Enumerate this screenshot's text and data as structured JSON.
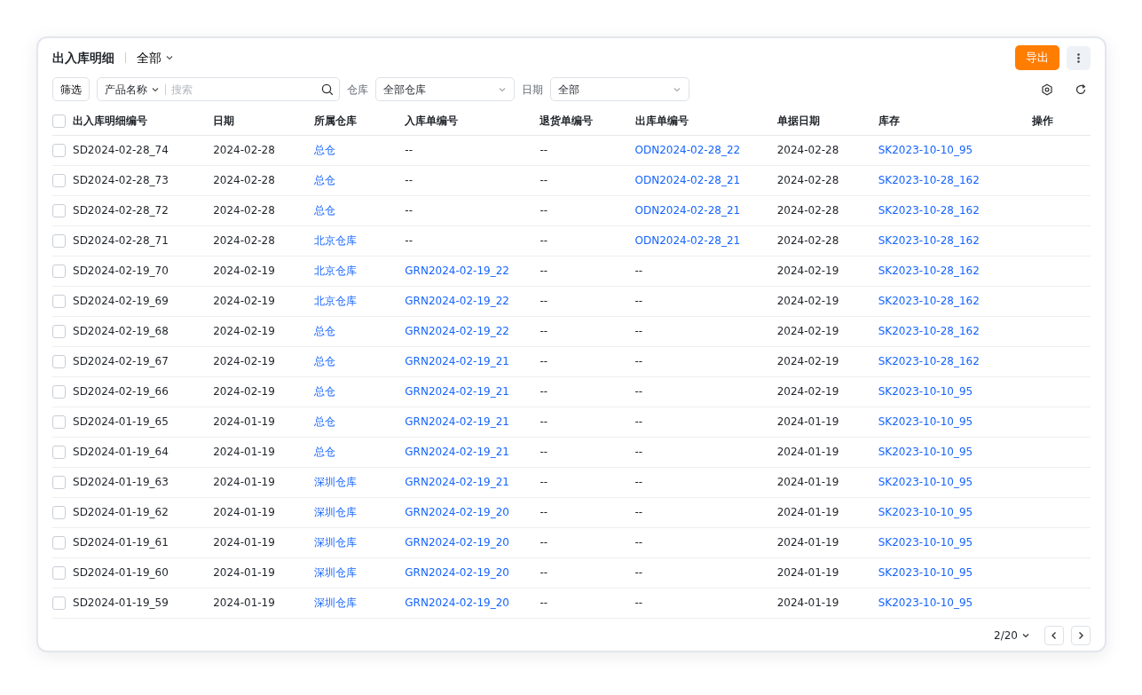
{
  "header": {
    "title": "出入库明细",
    "scope": "全部",
    "export": "导出"
  },
  "filters": {
    "filter_button": "筛选",
    "field": "产品名称",
    "search": {
      "placeholder": "搜索"
    },
    "warehouse_label": "仓库",
    "warehouse": "全部仓库",
    "date_label": "日期",
    "date": "全部"
  },
  "table": {
    "all_checked": false,
    "columns": [
      "出入库明细编号",
      "日期",
      "所属仓库",
      "入库单编号",
      "退货单编号",
      "出库单编号",
      "单据日期",
      "库存",
      "操作"
    ],
    "rows": [
      {
        "checked": false,
        "cells": [
          {
            "text": "SD2024-02-28_74",
            "link": false
          },
          {
            "text": "2024-02-28",
            "link": false
          },
          {
            "text": "总仓",
            "link": true
          },
          {
            "text": "--",
            "link": false
          },
          {
            "text": "--",
            "link": false
          },
          {
            "text": "ODN2024-02-28_22",
            "link": true
          },
          {
            "text": "2024-02-28",
            "link": false
          },
          {
            "text": "SK2023-10-10_95",
            "link": true
          }
        ]
      },
      {
        "checked": false,
        "cells": [
          {
            "text": "SD2024-02-28_73",
            "link": false
          },
          {
            "text": "2024-02-28",
            "link": false
          },
          {
            "text": "总仓",
            "link": true
          },
          {
            "text": "--",
            "link": false
          },
          {
            "text": "--",
            "link": false
          },
          {
            "text": "ODN2024-02-28_21",
            "link": true
          },
          {
            "text": "2024-02-28",
            "link": false
          },
          {
            "text": "SK2023-10-28_162",
            "link": true
          }
        ]
      },
      {
        "checked": false,
        "cells": [
          {
            "text": "SD2024-02-28_72",
            "link": false
          },
          {
            "text": "2024-02-28",
            "link": false
          },
          {
            "text": "总仓",
            "link": true
          },
          {
            "text": "--",
            "link": false
          },
          {
            "text": "--",
            "link": false
          },
          {
            "text": "ODN2024-02-28_21",
            "link": true
          },
          {
            "text": "2024-02-28",
            "link": false
          },
          {
            "text": "SK2023-10-28_162",
            "link": true
          }
        ]
      },
      {
        "checked": false,
        "cells": [
          {
            "text": "SD2024-02-28_71",
            "link": false
          },
          {
            "text": "2024-02-28",
            "link": false
          },
          {
            "text": "北京仓库",
            "link": true
          },
          {
            "text": "--",
            "link": false
          },
          {
            "text": "--",
            "link": false
          },
          {
            "text": "ODN2024-02-28_21",
            "link": true
          },
          {
            "text": "2024-02-28",
            "link": false
          },
          {
            "text": "SK2023-10-28_162",
            "link": true
          }
        ]
      },
      {
        "checked": false,
        "cells": [
          {
            "text": "SD2024-02-19_70",
            "link": false
          },
          {
            "text": "2024-02-19",
            "link": false
          },
          {
            "text": "北京仓库",
            "link": true
          },
          {
            "text": "GRN2024-02-19_22",
            "link": true
          },
          {
            "text": "--",
            "link": false
          },
          {
            "text": "--",
            "link": false
          },
          {
            "text": "2024-02-19",
            "link": false
          },
          {
            "text": "SK2023-10-28_162",
            "link": true
          }
        ]
      },
      {
        "checked": false,
        "cells": [
          {
            "text": "SD2024-02-19_69",
            "link": false
          },
          {
            "text": "2024-02-19",
            "link": false
          },
          {
            "text": "北京仓库",
            "link": true
          },
          {
            "text": "GRN2024-02-19_22",
            "link": true
          },
          {
            "text": "--",
            "link": false
          },
          {
            "text": "--",
            "link": false
          },
          {
            "text": "2024-02-19",
            "link": false
          },
          {
            "text": "SK2023-10-28_162",
            "link": true
          }
        ]
      },
      {
        "checked": false,
        "cells": [
          {
            "text": "SD2024-02-19_68",
            "link": false
          },
          {
            "text": "2024-02-19",
            "link": false
          },
          {
            "text": "总仓",
            "link": true
          },
          {
            "text": "GRN2024-02-19_22",
            "link": true
          },
          {
            "text": "--",
            "link": false
          },
          {
            "text": "--",
            "link": false
          },
          {
            "text": "2024-02-19",
            "link": false
          },
          {
            "text": "SK2023-10-28_162",
            "link": true
          }
        ]
      },
      {
        "checked": false,
        "cells": [
          {
            "text": "SD2024-02-19_67",
            "link": false
          },
          {
            "text": "2024-02-19",
            "link": false
          },
          {
            "text": "总仓",
            "link": true
          },
          {
            "text": "GRN2024-02-19_21",
            "link": true
          },
          {
            "text": "--",
            "link": false
          },
          {
            "text": "--",
            "link": false
          },
          {
            "text": "2024-02-19",
            "link": false
          },
          {
            "text": "SK2023-10-28_162",
            "link": true
          }
        ]
      },
      {
        "checked": false,
        "cells": [
          {
            "text": "SD2024-02-19_66",
            "link": false
          },
          {
            "text": "2024-02-19",
            "link": false
          },
          {
            "text": "总仓",
            "link": true
          },
          {
            "text": "GRN2024-02-19_21",
            "link": true
          },
          {
            "text": "--",
            "link": false
          },
          {
            "text": "--",
            "link": false
          },
          {
            "text": "2024-02-19",
            "link": false
          },
          {
            "text": "SK2023-10-10_95",
            "link": true
          }
        ]
      },
      {
        "checked": false,
        "cells": [
          {
            "text": "SD2024-01-19_65",
            "link": false
          },
          {
            "text": "2024-01-19",
            "link": false
          },
          {
            "text": "总仓",
            "link": true
          },
          {
            "text": "GRN2024-02-19_21",
            "link": true
          },
          {
            "text": "--",
            "link": false
          },
          {
            "text": "--",
            "link": false
          },
          {
            "text": "2024-01-19",
            "link": false
          },
          {
            "text": "SK2023-10-10_95",
            "link": true
          }
        ]
      },
      {
        "checked": false,
        "cells": [
          {
            "text": "SD2024-01-19_64",
            "link": false
          },
          {
            "text": "2024-01-19",
            "link": false
          },
          {
            "text": "总仓",
            "link": true
          },
          {
            "text": "GRN2024-02-19_21",
            "link": true
          },
          {
            "text": "--",
            "link": false
          },
          {
            "text": "--",
            "link": false
          },
          {
            "text": "2024-01-19",
            "link": false
          },
          {
            "text": "SK2023-10-10_95",
            "link": true
          }
        ]
      },
      {
        "checked": false,
        "cells": [
          {
            "text": "SD2024-01-19_63",
            "link": false
          },
          {
            "text": "2024-01-19",
            "link": false
          },
          {
            "text": "深圳仓库",
            "link": true
          },
          {
            "text": "GRN2024-02-19_21",
            "link": true
          },
          {
            "text": "--",
            "link": false
          },
          {
            "text": "--",
            "link": false
          },
          {
            "text": "2024-01-19",
            "link": false
          },
          {
            "text": "SK2023-10-10_95",
            "link": true
          }
        ]
      },
      {
        "checked": false,
        "cells": [
          {
            "text": "SD2024-01-19_62",
            "link": false
          },
          {
            "text": "2024-01-19",
            "link": false
          },
          {
            "text": "深圳仓库",
            "link": true
          },
          {
            "text": "GRN2024-02-19_20",
            "link": true
          },
          {
            "text": "--",
            "link": false
          },
          {
            "text": "--",
            "link": false
          },
          {
            "text": "2024-01-19",
            "link": false
          },
          {
            "text": "SK2023-10-10_95",
            "link": true
          }
        ]
      },
      {
        "checked": false,
        "cells": [
          {
            "text": "SD2024-01-19_61",
            "link": false
          },
          {
            "text": "2024-01-19",
            "link": false
          },
          {
            "text": "深圳仓库",
            "link": true
          },
          {
            "text": "GRN2024-02-19_20",
            "link": true
          },
          {
            "text": "--",
            "link": false
          },
          {
            "text": "--",
            "link": false
          },
          {
            "text": "2024-01-19",
            "link": false
          },
          {
            "text": "SK2023-10-10_95",
            "link": true
          }
        ]
      },
      {
        "checked": false,
        "cells": [
          {
            "text": "SD2024-01-19_60",
            "link": false
          },
          {
            "text": "2024-01-19",
            "link": false
          },
          {
            "text": "深圳仓库",
            "link": true
          },
          {
            "text": "GRN2024-02-19_20",
            "link": true
          },
          {
            "text": "--",
            "link": false
          },
          {
            "text": "--",
            "link": false
          },
          {
            "text": "2024-01-19",
            "link": false
          },
          {
            "text": "SK2023-10-10_95",
            "link": true
          }
        ]
      },
      {
        "checked": false,
        "cells": [
          {
            "text": "SD2024-01-19_59",
            "link": false
          },
          {
            "text": "2024-01-19",
            "link": false
          },
          {
            "text": "深圳仓库",
            "link": true
          },
          {
            "text": "GRN2024-02-19_20",
            "link": true
          },
          {
            "text": "--",
            "link": false
          },
          {
            "text": "--",
            "link": false
          },
          {
            "text": "2024-01-19",
            "link": false
          },
          {
            "text": "SK2023-10-10_95",
            "link": true
          }
        ]
      }
    ]
  },
  "pagination": {
    "page": "2/20"
  }
}
